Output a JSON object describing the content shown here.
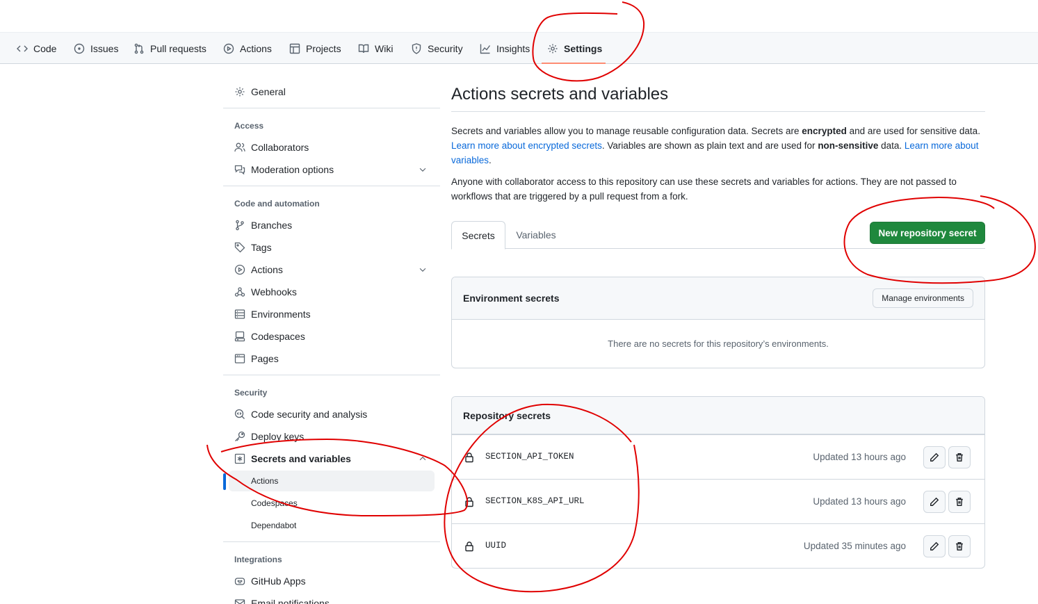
{
  "repo_nav": {
    "tabs": [
      {
        "label": "Code",
        "icon": "code-icon"
      },
      {
        "label": "Issues",
        "icon": "issue-opened-icon"
      },
      {
        "label": "Pull requests",
        "icon": "git-pull-request-icon"
      },
      {
        "label": "Actions",
        "icon": "play-icon"
      },
      {
        "label": "Projects",
        "icon": "table-icon"
      },
      {
        "label": "Wiki",
        "icon": "book-icon"
      },
      {
        "label": "Security",
        "icon": "shield-icon"
      },
      {
        "label": "Insights",
        "icon": "graph-icon"
      },
      {
        "label": "Settings",
        "icon": "gear-icon"
      }
    ],
    "active": "Settings",
    "active_underline_color": "#fd8c73"
  },
  "sidebar": {
    "general": "General",
    "access_heading": "Access",
    "collaborators": "Collaborators",
    "moderation": "Moderation options",
    "code_automation_heading": "Code and automation",
    "branches": "Branches",
    "tags": "Tags",
    "actions": "Actions",
    "webhooks": "Webhooks",
    "environments": "Environments",
    "codespaces": "Codespaces",
    "pages": "Pages",
    "security_heading": "Security",
    "code_security": "Code security and analysis",
    "deploy_keys": "Deploy keys",
    "secrets_variables": "Secrets and variables",
    "sub_actions": "Actions",
    "sub_codespaces": "Codespaces",
    "sub_dependabot": "Dependabot",
    "integrations_heading": "Integrations",
    "github_apps": "GitHub Apps",
    "email_notifications": "Email notifications"
  },
  "main": {
    "title": "Actions secrets and variables",
    "desc1_a": "Secrets and variables allow you to manage reusable configuration data. Secrets are ",
    "desc1_b": "encrypted",
    "desc1_c": " and are used for sensitive data. ",
    "desc1_link1": "Learn more about encrypted secrets",
    "desc1_d": ". Variables are shown as plain text and are used for ",
    "desc1_e": "non-sensitive",
    "desc1_f": " data. ",
    "desc1_link2": "Learn more about variables",
    "desc1_g": ".",
    "desc2": "Anyone with collaborator access to this repository can use these secrets and variables for actions. They are not passed to workflows that are triggered by a pull request from a fork.",
    "tab_secrets": "Secrets",
    "tab_variables": "Variables",
    "new_secret_button": "New repository secret",
    "env_secrets_heading": "Environment secrets",
    "manage_environments": "Manage environments",
    "env_empty": "There are no secrets for this repository’s environments.",
    "repo_secrets_heading": "Repository secrets",
    "secrets": [
      {
        "name": "SECTION_API_TOKEN",
        "updated": "Updated 13 hours ago"
      },
      {
        "name": "SECTION_K8S_API_URL",
        "updated": "Updated 13 hours ago"
      },
      {
        "name": "UUID",
        "updated": "Updated 35 minutes ago"
      }
    ]
  },
  "colors": {
    "primary_button": "#1f883d",
    "link": "#0969da",
    "annotation": "#e00000"
  }
}
